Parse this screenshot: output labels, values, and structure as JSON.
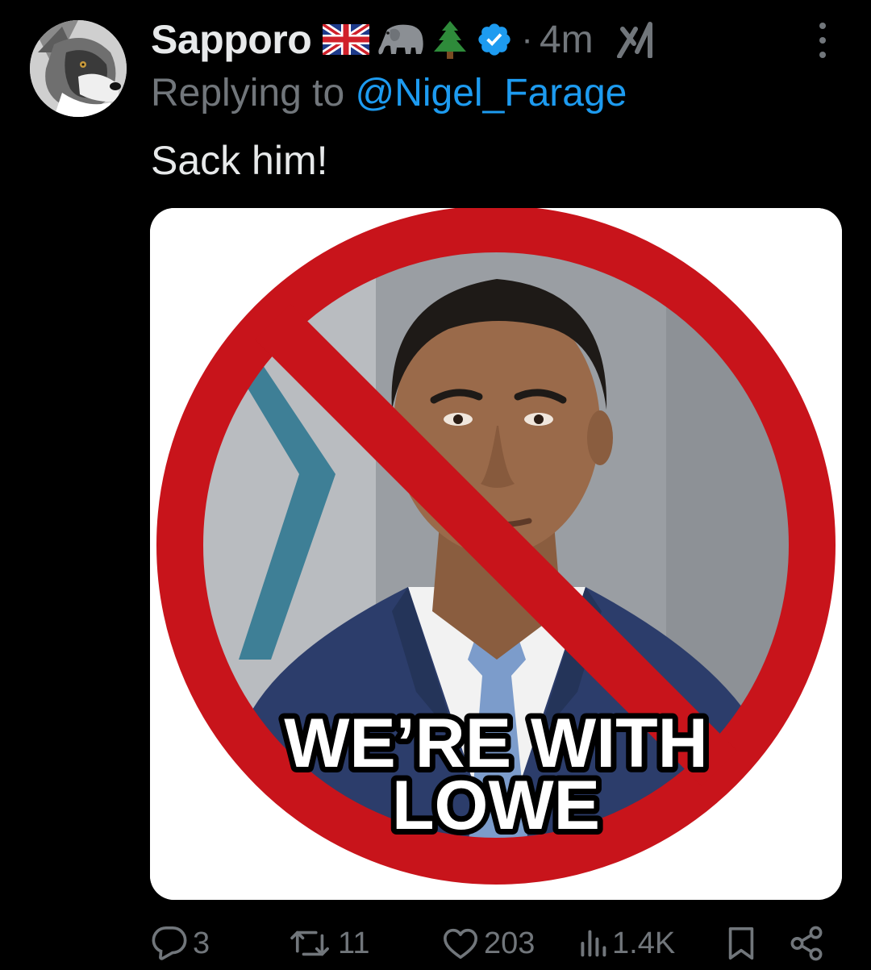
{
  "tweet": {
    "display_name": "Sapporo",
    "name_emojis": [
      "uk-flag",
      "elephant",
      "evergreen-tree"
    ],
    "verified": true,
    "separator": "·",
    "timestamp": "4m",
    "replying_prefix": "Replying to ",
    "replying_handle": "@Nigel_Farage",
    "text": "Sack him!",
    "media": {
      "overlay_line_1": "WE’RE WITH",
      "overlay_line_2": "LOWE"
    }
  },
  "actions": {
    "replies": "3",
    "reposts": "11",
    "likes": "203",
    "views": "1.4K"
  },
  "icons": {
    "avatar": "wolf-avatar",
    "verified": "verified-badge-icon",
    "grok": "grok-icon",
    "more": "more-options-icon",
    "reply": "reply-icon",
    "repost": "repost-icon",
    "like": "heart-icon",
    "views": "views-icon",
    "bookmark": "bookmark-icon",
    "share": "share-icon"
  },
  "colors": {
    "background": "#000000",
    "primary_text": "#e7e9ea",
    "secondary_text": "#71767b",
    "link": "#1d9bf0",
    "prohibition_red": "#c8141b"
  }
}
